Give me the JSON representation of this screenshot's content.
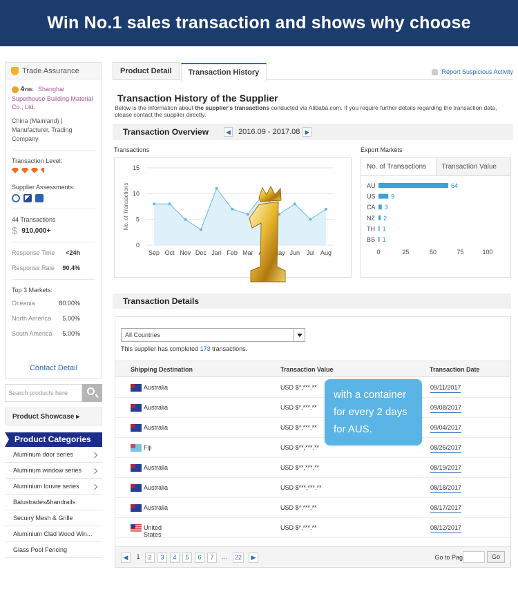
{
  "banner": {
    "title": "Win No.1 sales transaction and shows why choose"
  },
  "supplier": {
    "trade_assurance": "Trade Assurance",
    "years": "4",
    "years_unit": "YRS",
    "name": "Shanghai Superhouse Building Material Co., Ltd.",
    "location": "China (Mainland) | Manufacturer, Trading Company",
    "transaction_level_label": "Transaction Level:",
    "assessments_label": "Supplier Assessments:",
    "transactions_count": "44 Transactions",
    "transactions_value": "910,000+",
    "response_time_label": "Response Time",
    "response_time": "<24h",
    "response_rate_label": "Response Rate",
    "response_rate": "90.4%",
    "top_markets_label": "Top 3 Markets:",
    "top_markets": [
      {
        "name": "Oceania",
        "value": "80.00%"
      },
      {
        "name": "North America",
        "value": "5.00%"
      },
      {
        "name": "South America",
        "value": "5.00%"
      }
    ],
    "contact_label": "Contact Detail",
    "colors": {
      "diamond": "#f26d21",
      "gold": "#e9a227"
    }
  },
  "sidebar": {
    "search_placeholder": "Search products here",
    "showcase_label": "Product Showcase ▸",
    "categories_label": "Product Categories",
    "categories": [
      "Aluminum door series",
      "Aluminum window series",
      "Aluminium louvre series",
      "Balustrades&handrails",
      "Secuiry Mesh & Grille",
      "Aluminium Clad Wood Win...",
      "Glass Pool Fencing"
    ]
  },
  "tabs": {
    "detail": "Product Detail",
    "history": "Transaction History",
    "report": "Report Suspicious Activity"
  },
  "history": {
    "title": "Transaction History of the Supplier",
    "intro_a": "Below is the information about ",
    "intro_b": "the supplier's transactions",
    "intro_c": " conducted via Alibaba.com. If you require further details regarding the transaction data, please contact the supplier directly.",
    "overview_label": "Transaction Overview",
    "period": "2016.09 - 2017.08",
    "transactions_label": "Transactions",
    "export_label": "Export Markets",
    "export_tab_active": "No. of Transactions",
    "export_tab_other": "Transaction Value"
  },
  "chart_data": [
    {
      "type": "area",
      "title": "",
      "ylabel": "No. of Transactions",
      "xlabel": "",
      "categories": [
        "Sep",
        "Oct",
        "Nov",
        "Dec",
        "Jan",
        "Feb",
        "Mar",
        "Apr",
        "May",
        "Jun",
        "Jul",
        "Aug"
      ],
      "values": [
        8,
        8,
        5,
        3,
        11,
        7,
        6,
        10,
        6,
        8,
        5,
        7
      ],
      "ylim": [
        0,
        15
      ],
      "yticks": [
        0,
        5,
        10,
        15
      ],
      "grid": true,
      "colors": {
        "line": "#66b8df",
        "fill": "#daeefa"
      }
    },
    {
      "type": "bar",
      "orientation": "horizontal",
      "title": "",
      "categories": [
        "AU",
        "US",
        "CA",
        "NZ",
        "TH",
        "BS"
      ],
      "values": [
        64,
        9,
        3,
        2,
        1,
        1
      ],
      "xlim": [
        0,
        100
      ],
      "xticks": [
        0,
        25,
        50,
        75,
        100
      ],
      "colors": {
        "bar": "#3aa2da"
      }
    }
  ],
  "details": {
    "title": "Transaction Details",
    "country_select": "All Countries",
    "completed_a": "This supplier has completed ",
    "completed_n": "173",
    "completed_b": " transactions.",
    "headers": {
      "dest": "Shipping Destination",
      "value": "Transaction Value",
      "date": "Transaction Date"
    },
    "rows": [
      {
        "flag": "au",
        "dest": "Australia",
        "value": "USD $*,***.**",
        "date": "09/11/2017"
      },
      {
        "flag": "au",
        "dest": "Australia",
        "value": "USD $*,***.**",
        "date": "09/08/2017"
      },
      {
        "flag": "au",
        "dest": "Australia",
        "value": "USD $*,***.**",
        "date": "09/04/2017"
      },
      {
        "flag": "fj",
        "dest": "Fiji",
        "value": "USD $**,***.**",
        "date": "08/26/2017"
      },
      {
        "flag": "au",
        "dest": "Australia",
        "value": "USD $**,***.**",
        "date": "08/19/2017"
      },
      {
        "flag": "au",
        "dest": "Australia",
        "value": "USD $***,***.**",
        "date": "08/18/2017"
      },
      {
        "flag": "au",
        "dest": "Australia",
        "value": "USD $*,***.**",
        "date": "08/17/2017"
      },
      {
        "flag": "us",
        "dest": "United States",
        "value": "USD $*,***.**",
        "date": "08/12/2017"
      }
    ],
    "pages": [
      "1",
      "2",
      "3",
      "4",
      "5",
      "6",
      "7",
      "...",
      "22"
    ],
    "goto_label": "Go to Page",
    "go_label": "Go"
  },
  "callout": {
    "text": "with a container for every 2 days for AUS."
  }
}
